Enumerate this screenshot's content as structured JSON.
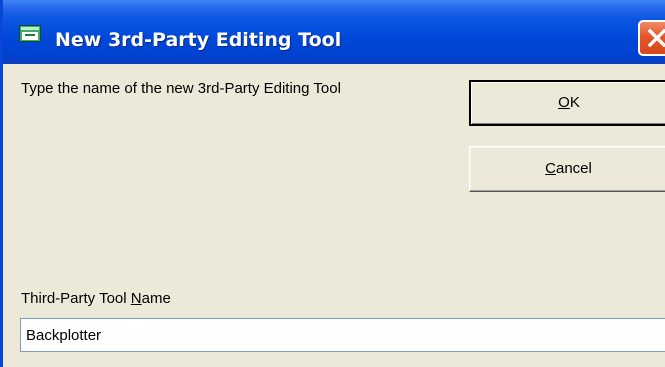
{
  "window": {
    "title": "New 3rd-Party Editing Tool",
    "icon": "app-window-icon",
    "close_icon": "close-icon",
    "colors": {
      "titlebar": "#0048d9",
      "close_button": "#e4572b",
      "dialog_background": "#ece9d8"
    }
  },
  "dialog": {
    "prompt": "Type the name of the new 3rd-Party Editing Tool",
    "ok_button": {
      "mnemonic": "O",
      "rest": "K"
    },
    "cancel_button": {
      "mnemonic": "C",
      "rest": "ancel"
    },
    "name_field": {
      "label_before": "Third-Party Tool ",
      "label_mnemonic": "N",
      "label_after": "ame",
      "value": "Backplotter"
    }
  }
}
